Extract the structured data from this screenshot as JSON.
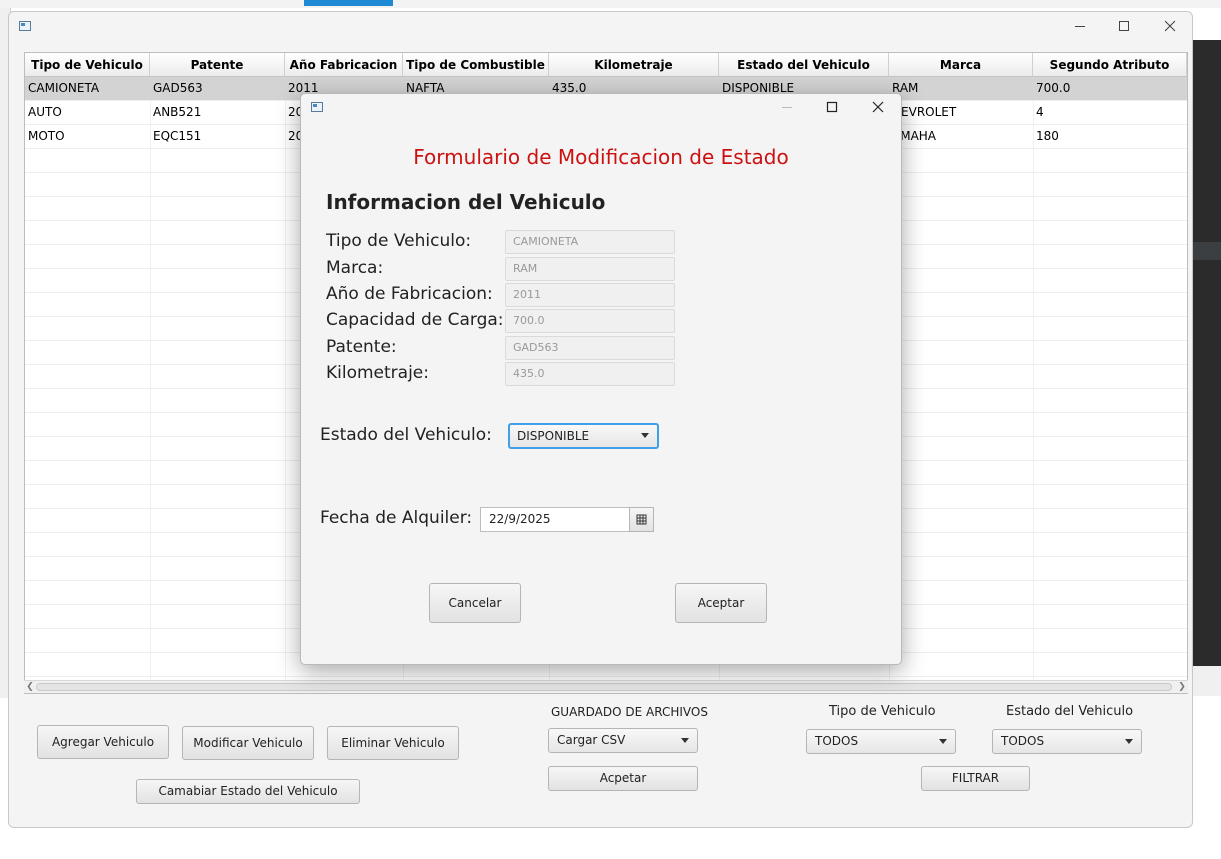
{
  "table": {
    "columns": [
      "Tipo de Vehiculo",
      "Patente",
      "Año Fabricacion",
      "Tipo de Combustible",
      "Kilometraje",
      "Estado del Vehiculo",
      "Marca",
      "Segundo Atributo"
    ],
    "rows": [
      {
        "tipo": "CAMIONETA",
        "patente": "GAD563",
        "anio": "2011",
        "combustible": "NAFTA",
        "km": "435.0",
        "estado": "DISPONIBLE",
        "marca": "RAM",
        "segundo": "700.0"
      },
      {
        "tipo": "AUTO",
        "patente": "ANB521",
        "anio": "20",
        "marca": "HEVROLET",
        "segundo": "4"
      },
      {
        "tipo": "MOTO",
        "patente": "EQC151",
        "anio": "20",
        "marca": "AMAHA",
        "segundo": "180"
      }
    ]
  },
  "buttons": {
    "agregar": "Agregar Vehiculo",
    "modificar": "Modificar Vehiculo",
    "eliminar": "Eliminar Vehiculo",
    "cambiar_estado": "Camabiar Estado del Vehiculo",
    "aceptar_csv": "Acpetar",
    "filtrar": "FILTRAR"
  },
  "files": {
    "title": "GUARDADO DE ARCHIVOS",
    "select": "Cargar CSV",
    "title_color": "#d11a1a"
  },
  "filters": {
    "tipo_label": "Tipo de Vehiculo",
    "tipo_value": "TODOS",
    "estado_label": "Estado del Vehiculo",
    "estado_value": "TODOS"
  },
  "dialog": {
    "title": "Formulario de Modificacion de Estado",
    "title_color": "#cc1111",
    "section": "Informacion del Vehiculo",
    "fields": [
      {
        "label": "Tipo de Vehiculo:",
        "value": "CAMIONETA"
      },
      {
        "label": "Marca:",
        "value": "RAM"
      },
      {
        "label": "Año de Fabricacion:",
        "value": "2011"
      },
      {
        "label": "Capacidad de Carga:",
        "value": "700.0"
      },
      {
        "label": "Patente:",
        "value": "GAD563"
      },
      {
        "label": "Kilometraje:",
        "value": "435.0"
      }
    ],
    "estado_label": "Estado del Vehiculo:",
    "estado_value": "DISPONIBLE",
    "fecha_label": "Fecha de Alquiler:",
    "fecha_value": "22/9/2025",
    "cancel": "Cancelar",
    "accept": "Aceptar"
  },
  "icons": {
    "minimize": "minimize-icon",
    "maximize": "maximize-icon",
    "close": "close-icon",
    "calendar": "calendar-icon",
    "dropdown": "chevron-down-icon"
  }
}
